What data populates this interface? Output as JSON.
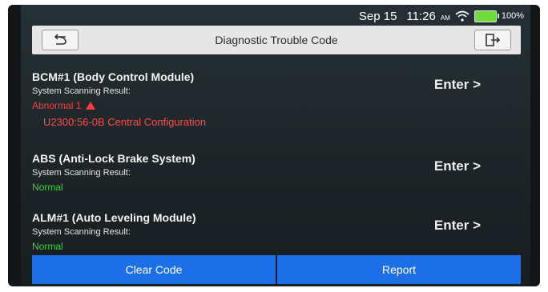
{
  "status": {
    "date": "Sep 15",
    "time": "11:26",
    "ampm": "AM",
    "battery": "100%"
  },
  "header": {
    "title": "Diagnostic Trouble Code",
    "back_icon": "back-arrow-icon",
    "exit_icon": "exit-icon"
  },
  "modules": [
    {
      "name": "BCM#1 (Body Control Module)",
      "scan_label": "System Scanning Result:",
      "result": "Abnormal 1",
      "status": "abnormal",
      "dtc": "U2300:56-0B Central Configuration",
      "enter": "Enter >"
    },
    {
      "name": "ABS (Anti-Lock Brake System)",
      "scan_label": "System Scanning Result:",
      "result": "Normal",
      "status": "normal",
      "enter": "Enter >"
    },
    {
      "name": "ALM#1 (Auto Leveling Module)",
      "scan_label": "System Scanning Result:",
      "result": "Normal",
      "status": "normal",
      "enter": "Enter >"
    }
  ],
  "footer": {
    "clear_code": "Clear Code",
    "report": "Report"
  },
  "colors": {
    "abnormal": "#ff3b3b",
    "normal": "#42d13c",
    "button": "#1d6fe8"
  }
}
